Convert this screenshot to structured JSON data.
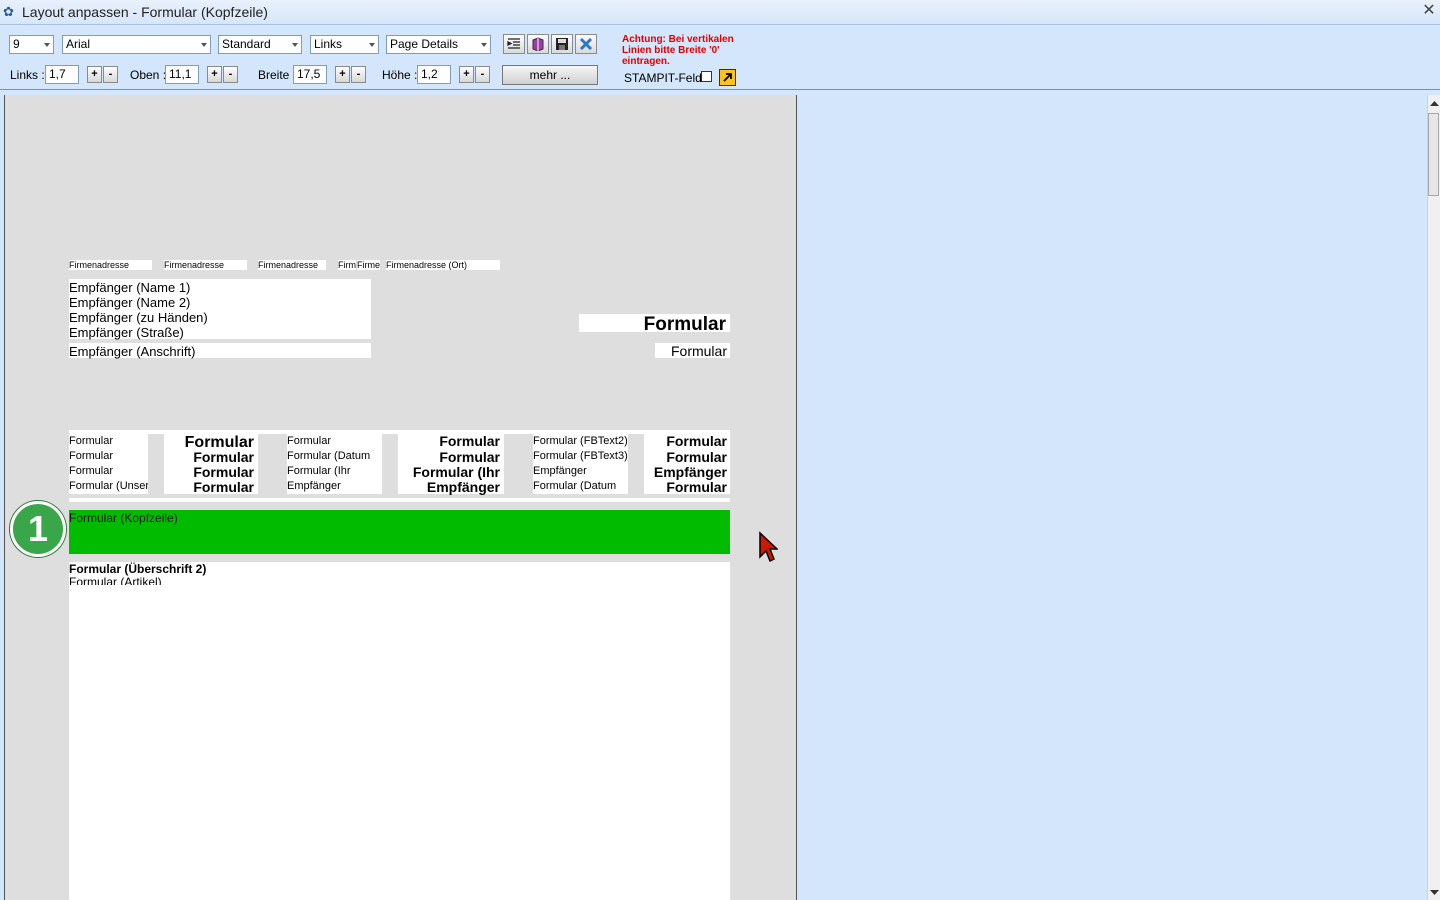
{
  "window": {
    "title": "Layout anpassen - Formular (Kopfzeile)",
    "close_glyph": "✕"
  },
  "toolbar": {
    "font_size": "9",
    "font_name": "Arial",
    "style": "Standard",
    "align": "Links",
    "section": "Page Details",
    "links_label": "Links :",
    "links_value": "1,7",
    "oben_label": "Oben :",
    "oben_value": "11,1",
    "breite_label": "Breite :",
    "breite_value": "17,5",
    "hoehe_label": "Höhe :",
    "hoehe_value": "1,2",
    "plus": "+",
    "minus": "-",
    "mehr_label": "mehr ...",
    "warning_text": "Achtung: Bei vertikalen Linien bitte Breite '0' eintragen.",
    "stampit_label": "STAMPIT-Feld",
    "icons": [
      "indent-icon",
      "book-icon",
      "save-icon",
      "delete-icon"
    ],
    "warning_color": "#e00000"
  },
  "canvas": {
    "firmenadresse": [
      "Firmenadresse",
      "Firmenadresse",
      "Firmenadresse",
      "Firm",
      "Firme",
      "Firmenadresse (Ort)"
    ],
    "empfaenger_lines": [
      "Empfänger (Name 1)",
      "Empfänger (Name 2)",
      "Empfänger (zu Händen)",
      "Empfänger (Straße)"
    ],
    "empfaenger_anschrift": "Empfänger (Anschrift)",
    "formular_big": "Formular",
    "formular_small": "Formular",
    "info_col1": [
      "Formular",
      "Formular",
      "Formular",
      "Formular (Unser"
    ],
    "info_col2": [
      "Formular",
      "Formular",
      "Formular",
      "Formular"
    ],
    "info_col3": [
      "Formular",
      "Formular (Datum",
      "Formular (Ihr",
      "Empfänger"
    ],
    "info_col4": [
      "Formular",
      "Formular",
      "Formular (Ihr",
      "Empfänger"
    ],
    "info_col5": [
      "Formular (FBText2)",
      "Formular (FBText3)",
      "Empfänger",
      "Formular (Datum"
    ],
    "info_col6": [
      "Formular",
      "Formular",
      "Empfänger",
      "Formular"
    ],
    "kopfzeile": "Formular (Kopfzeile)",
    "ueberschrift2": "Formular (Überschrift 2)",
    "artikel": "Formular (Artikel)",
    "badge_number": "1",
    "highlight_color": "#00bb00"
  }
}
